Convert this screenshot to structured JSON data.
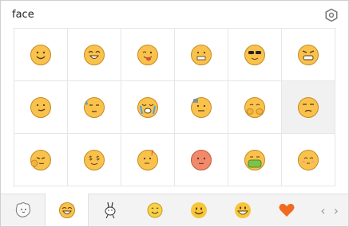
{
  "header": {
    "title": "face"
  },
  "grid": {
    "hover_index": 11,
    "items": [
      {
        "icon": "smile-face-icon"
      },
      {
        "icon": "laugh-face-icon"
      },
      {
        "icon": "tongue-face-icon"
      },
      {
        "icon": "grimace-face-icon"
      },
      {
        "icon": "sunglasses-face-icon"
      },
      {
        "icon": "angry-teeth-face-icon"
      },
      {
        "icon": "smirk-face-icon"
      },
      {
        "icon": "sweat-face-icon"
      },
      {
        "icon": "crying-face-icon"
      },
      {
        "icon": "awkward-face-icon"
      },
      {
        "icon": "hands-cover-face-icon"
      },
      {
        "icon": "frown-face-icon"
      },
      {
        "icon": "wave-face-icon"
      },
      {
        "icon": "money-face-icon"
      },
      {
        "icon": "question-face-icon"
      },
      {
        "icon": "blush-face-icon"
      },
      {
        "icon": "sick-face-icon"
      },
      {
        "icon": "shy-face-icon"
      }
    ]
  },
  "tabs": [
    {
      "icon": "bear-sticker-icon",
      "active": false
    },
    {
      "icon": "qq-face-icon",
      "active": true
    },
    {
      "icon": "rabbit-sticker-icon",
      "active": false
    },
    {
      "icon": "smile-emoji-icon",
      "active": false
    },
    {
      "icon": "grin-emoji-icon",
      "active": false
    },
    {
      "icon": "big-grin-emoji-icon",
      "active": false
    },
    {
      "icon": "heart-icon",
      "active": false
    }
  ],
  "colors": {
    "face_fill": "#f9c24d",
    "face_stroke": "#c58a20",
    "accent_orange": "#f06b1f",
    "hover_bg": "#f1f1f1"
  }
}
